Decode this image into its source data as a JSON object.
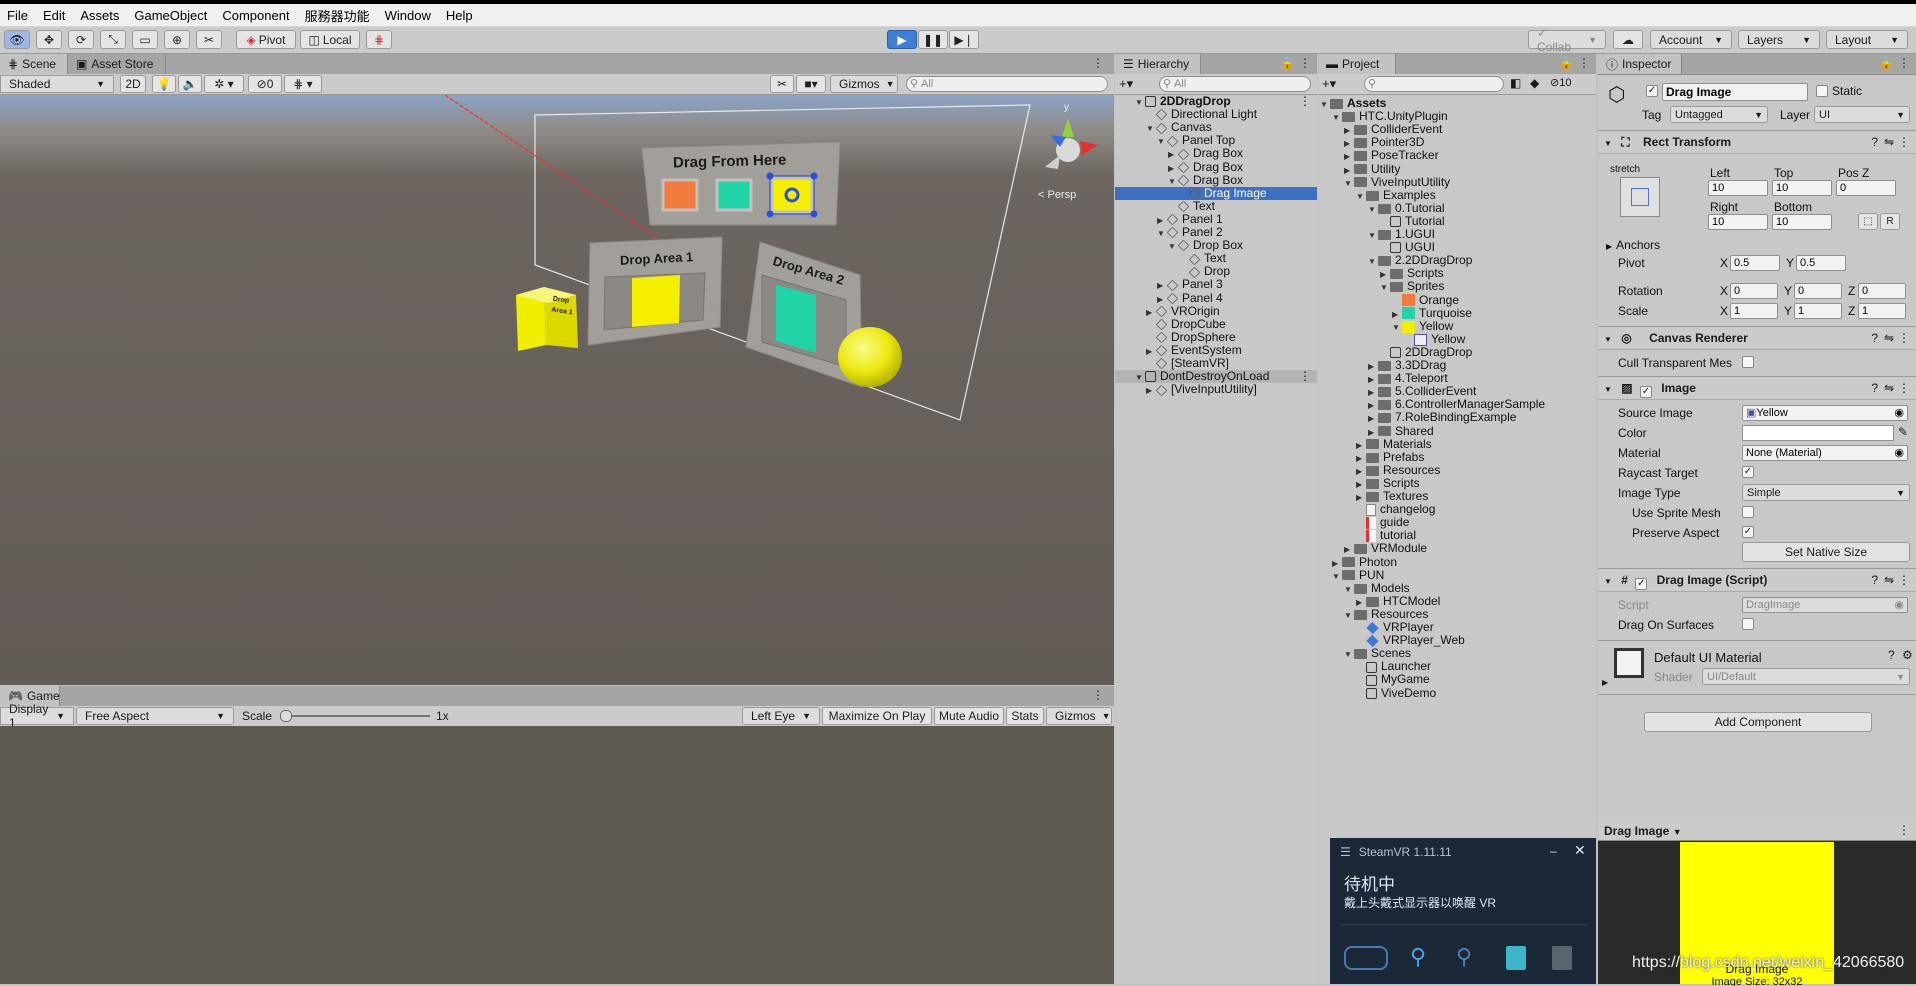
{
  "menu": [
    "File",
    "Edit",
    "Assets",
    "GameObject",
    "Component",
    "服務器功能",
    "Window",
    "Help"
  ],
  "toolbar": {
    "pivot_label": "Pivot",
    "local_label": "Local",
    "collab_label": "Collab",
    "account_label": "Account",
    "layers_label": "Layers",
    "layout_label": "Layout"
  },
  "scene": {
    "tab_scene": "Scene",
    "tab_asset_store": "Asset Store",
    "shading_mode": "Shaded",
    "mode_2d": "2D",
    "hidden_count": "0",
    "gizmos_label": "Gizmos",
    "search_placeholder": "All",
    "persp_label": "< Persp",
    "drag_from_here": "Drag From Here",
    "drop_area_1": "Drop Area 1",
    "drop_area_2": "Drop Area 2",
    "cube_label": "Drop Area 1",
    "colors": {
      "orange": "#f07b3c",
      "turquoise": "#20d4a8",
      "yellow": "#f4ef00"
    }
  },
  "game": {
    "tab_game": "Game",
    "display": "Display 1",
    "aspect": "Free Aspect",
    "scale_label": "Scale",
    "scale_value": "1x",
    "eye": "Left Eye",
    "maximize": "Maximize On Play",
    "mute": "Mute Audio",
    "stats": "Stats",
    "gizmos": "Gizmos"
  },
  "hierarchy": {
    "tab": "Hierarchy",
    "search_placeholder": "All",
    "rows": [
      {
        "label": "2DDragDrop",
        "indent": 0,
        "arrow": "▼",
        "icon": "scene",
        "bold": true
      },
      {
        "label": "Directional Light",
        "indent": 1,
        "arrow": "",
        "icon": "go"
      },
      {
        "label": "Canvas",
        "indent": 1,
        "arrow": "▼",
        "icon": "go"
      },
      {
        "label": "Panel Top",
        "indent": 2,
        "arrow": "▼",
        "icon": "go"
      },
      {
        "label": "Drag Box",
        "indent": 3,
        "arrow": "▶",
        "icon": "go"
      },
      {
        "label": "Drag Box",
        "indent": 3,
        "arrow": "▶",
        "icon": "go"
      },
      {
        "label": "Drag Box",
        "indent": 3,
        "arrow": "▼",
        "icon": "go"
      },
      {
        "label": "Drag Image",
        "indent": 4,
        "arrow": "",
        "icon": "go",
        "selected": true
      },
      {
        "label": "Text",
        "indent": 3,
        "arrow": "",
        "icon": "go"
      },
      {
        "label": "Panel 1",
        "indent": 2,
        "arrow": "▶",
        "icon": "go"
      },
      {
        "label": "Panel 2",
        "indent": 2,
        "arrow": "▼",
        "icon": "go"
      },
      {
        "label": "Drop Box",
        "indent": 3,
        "arrow": "▼",
        "icon": "go"
      },
      {
        "label": "Text",
        "indent": 4,
        "arrow": "",
        "icon": "go"
      },
      {
        "label": "Drop",
        "indent": 4,
        "arrow": "",
        "icon": "go"
      },
      {
        "label": "Panel 3",
        "indent": 2,
        "arrow": "▶",
        "icon": "go"
      },
      {
        "label": "Panel 4",
        "indent": 2,
        "arrow": "▶",
        "icon": "go"
      },
      {
        "label": "VROrigin",
        "indent": 1,
        "arrow": "▶",
        "icon": "go"
      },
      {
        "label": "DropCube",
        "indent": 1,
        "arrow": "",
        "icon": "go"
      },
      {
        "label": "DropSphere",
        "indent": 1,
        "arrow": "",
        "icon": "go"
      },
      {
        "label": "EventSystem",
        "indent": 1,
        "arrow": "▶",
        "icon": "go"
      },
      {
        "label": "[SteamVR]",
        "indent": 1,
        "arrow": "",
        "icon": "go"
      },
      {
        "label": "DontDestroyOnLoad",
        "indent": 0,
        "arrow": "▼",
        "icon": "scene",
        "header": true
      },
      {
        "label": "[ViveInputUtility]",
        "indent": 1,
        "arrow": "▶",
        "icon": "go"
      }
    ]
  },
  "project": {
    "tab": "Project",
    "hidden_count": "10",
    "rows": [
      {
        "label": "Assets",
        "indent": 0,
        "arrow": "▼",
        "icon": "folder",
        "bold": true
      },
      {
        "label": "HTC.UnityPlugin",
        "indent": 1,
        "arrow": "▼",
        "icon": "folder"
      },
      {
        "label": "ColliderEvent",
        "indent": 2,
        "arrow": "▶",
        "icon": "folder"
      },
      {
        "label": "Pointer3D",
        "indent": 2,
        "arrow": "▶",
        "icon": "folder"
      },
      {
        "label": "PoseTracker",
        "indent": 2,
        "arrow": "▶",
        "icon": "folder"
      },
      {
        "label": "Utility",
        "indent": 2,
        "arrow": "▶",
        "icon": "folder"
      },
      {
        "label": "ViveInputUtility",
        "indent": 2,
        "arrow": "▼",
        "icon": "folder"
      },
      {
        "label": "Examples",
        "indent": 3,
        "arrow": "▼",
        "icon": "folder"
      },
      {
        "label": "0.Tutorial",
        "indent": 4,
        "arrow": "▼",
        "icon": "folder"
      },
      {
        "label": "Tutorial",
        "indent": 5,
        "arrow": "",
        "icon": "scene"
      },
      {
        "label": "1.UGUI",
        "indent": 4,
        "arrow": "▼",
        "icon": "folder"
      },
      {
        "label": "UGUI",
        "indent": 5,
        "arrow": "",
        "icon": "scene"
      },
      {
        "label": "2.2DDragDrop",
        "indent": 4,
        "arrow": "▼",
        "icon": "folder"
      },
      {
        "label": "Scripts",
        "indent": 5,
        "arrow": "▶",
        "icon": "folder"
      },
      {
        "label": "Sprites",
        "indent": 5,
        "arrow": "▼",
        "icon": "folder"
      },
      {
        "label": "Orange",
        "indent": 6,
        "arrow": "",
        "icon": "orange"
      },
      {
        "label": "Turquoise",
        "indent": 6,
        "arrow": "▶",
        "icon": "turquoise"
      },
      {
        "label": "Yellow",
        "indent": 6,
        "arrow": "▼",
        "icon": "yellow"
      },
      {
        "label": "Yellow",
        "indent": 7,
        "arrow": "",
        "icon": "sprite"
      },
      {
        "label": "2DDragDrop",
        "indent": 5,
        "arrow": "",
        "icon": "scene"
      },
      {
        "label": "3.3DDrag",
        "indent": 4,
        "arrow": "▶",
        "icon": "folder"
      },
      {
        "label": "4.Teleport",
        "indent": 4,
        "arrow": "▶",
        "icon": "folder"
      },
      {
        "label": "5.ColliderEvent",
        "indent": 4,
        "arrow": "▶",
        "icon": "folder"
      },
      {
        "label": "6.ControllerManagerSample",
        "indent": 4,
        "arrow": "▶",
        "icon": "folder"
      },
      {
        "label": "7.RoleBindingExample",
        "indent": 4,
        "arrow": "▶",
        "icon": "folder"
      },
      {
        "label": "Shared",
        "indent": 4,
        "arrow": "▶",
        "icon": "folder"
      },
      {
        "label": "Materials",
        "indent": 3,
        "arrow": "▶",
        "icon": "folder"
      },
      {
        "label": "Prefabs",
        "indent": 3,
        "arrow": "▶",
        "icon": "folder"
      },
      {
        "label": "Resources",
        "indent": 3,
        "arrow": "▶",
        "icon": "folder"
      },
      {
        "label": "Scripts",
        "indent": 3,
        "arrow": "▶",
        "icon": "folder"
      },
      {
        "label": "Textures",
        "indent": 3,
        "arrow": "▶",
        "icon": "folder"
      },
      {
        "label": "changelog",
        "indent": 3,
        "arrow": "",
        "icon": "doc"
      },
      {
        "label": "guide",
        "indent": 3,
        "arrow": "",
        "icon": "pdf"
      },
      {
        "label": "tutorial",
        "indent": 3,
        "arrow": "",
        "icon": "pdf"
      },
      {
        "label": "VRModule",
        "indent": 2,
        "arrow": "▶",
        "icon": "folder"
      },
      {
        "label": "Photon",
        "indent": 1,
        "arrow": "▶",
        "icon": "folder"
      },
      {
        "label": "PUN",
        "indent": 1,
        "arrow": "▼",
        "icon": "folder"
      },
      {
        "label": "Models",
        "indent": 2,
        "arrow": "▼",
        "icon": "folder"
      },
      {
        "label": "HTCModel",
        "indent": 3,
        "arrow": "▶",
        "icon": "folder"
      },
      {
        "label": "Resources",
        "indent": 2,
        "arrow": "▼",
        "icon": "folder"
      },
      {
        "label": "VRPlayer",
        "indent": 3,
        "arrow": "",
        "icon": "prefab"
      },
      {
        "label": "VRPlayer_Web",
        "indent": 3,
        "arrow": "",
        "icon": "prefab"
      },
      {
        "label": "Scenes",
        "indent": 2,
        "arrow": "▼",
        "icon": "folder"
      },
      {
        "label": "Launcher",
        "indent": 3,
        "arrow": "",
        "icon": "scene"
      },
      {
        "label": "MyGame",
        "indent": 3,
        "arrow": "",
        "icon": "scene"
      },
      {
        "label": "ViveDemo",
        "indent": 3,
        "arrow": "",
        "icon": "scene"
      }
    ]
  },
  "steamvr": {
    "title": "SteamVR 1.11.11",
    "status": "待机中",
    "message": "戴上头戴式显示器以唤醒 VR"
  },
  "inspector": {
    "tab": "Inspector",
    "object_name": "Drag Image",
    "static_label": "Static",
    "tag_label": "Tag",
    "tag_value": "Untagged",
    "layer_label": "Layer",
    "layer_value": "UI",
    "rect_transform": {
      "title": "Rect Transform",
      "stretch": "stretch",
      "left_label": "Left",
      "left": "10",
      "top_label": "Top",
      "top": "10",
      "posz_label": "Pos Z",
      "posz": "0",
      "right_label": "Right",
      "right": "10",
      "bottom_label": "Bottom",
      "bottom": "10",
      "r_button": "R",
      "anchors_label": "Anchors",
      "pivot_label": "Pivot",
      "pivot_x": "0.5",
      "pivot_y": "0.5",
      "rotation_label": "Rotation",
      "rot_x": "0",
      "rot_y": "0",
      "rot_z": "0",
      "scale_label": "Scale",
      "scale_x": "1",
      "scale_y": "1",
      "scale_z": "1",
      "x": "X",
      "y": "Y",
      "z": "Z"
    },
    "canvas_renderer": {
      "title": "Canvas Renderer",
      "cull_label": "Cull Transparent Mes"
    },
    "image": {
      "title": "Image",
      "source_image_label": "Source Image",
      "source_image": "Yellow",
      "color_label": "Color",
      "material_label": "Material",
      "material": "None (Material)",
      "raycast_label": "Raycast Target",
      "image_type_label": "Image Type",
      "image_type": "Simple",
      "sprite_mesh_label": "Use Sprite Mesh",
      "preserve_label": "Preserve Aspect",
      "native_size_button": "Set Native Size"
    },
    "drag_script": {
      "title": "Drag Image (Script)",
      "script_label": "Script",
      "script_value": "DragImage",
      "surfaces_label": "Drag On Surfaces"
    },
    "material": {
      "name": "Default UI Material",
      "shader_label": "Shader",
      "shader_value": "UI/Default"
    },
    "add_component": "Add Component",
    "preview": {
      "title": "Drag Image",
      "caption": "Drag Image",
      "size": "Image Size: 32x32"
    }
  },
  "watermark": "https://blog.csdn.net/weixin_42066580"
}
